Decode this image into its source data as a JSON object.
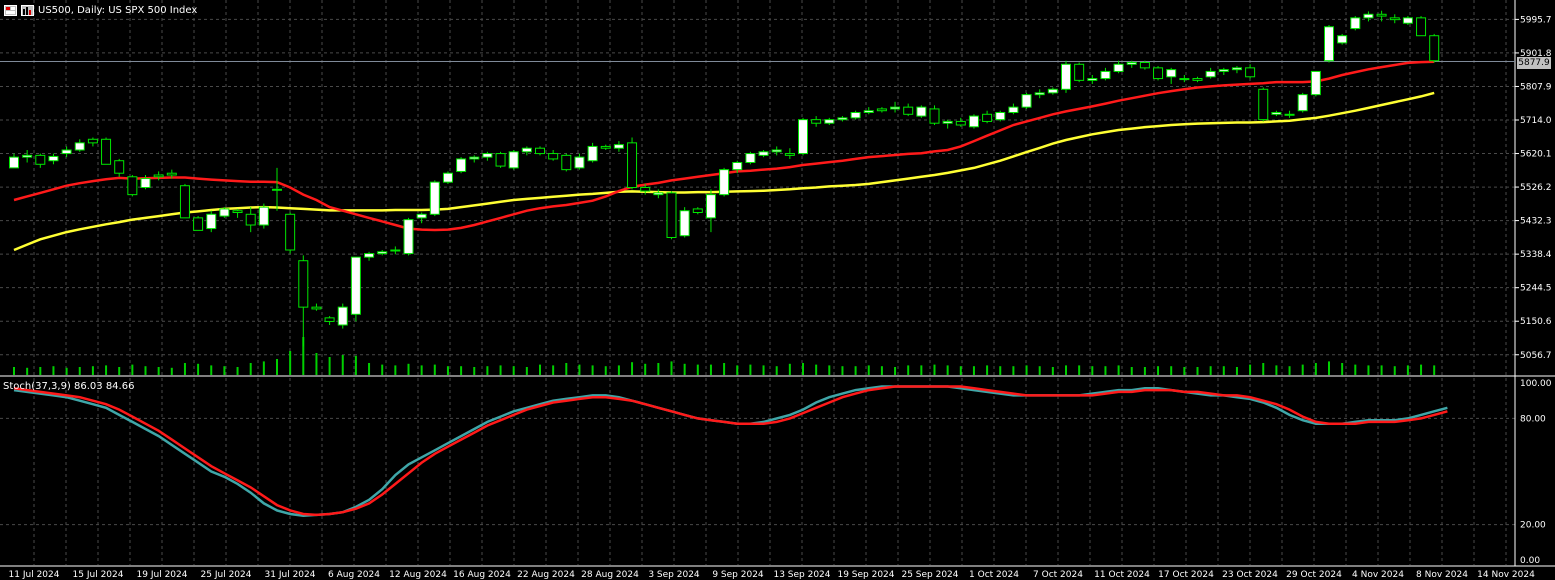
{
  "header": {
    "symbol": "US500",
    "timeframe": "Daily",
    "description": "US SPX 500 Index",
    "title": "US500, Daily:  US SPX 500 Index",
    "icons": [
      "window-grid-icon",
      "bar-chart-icon"
    ]
  },
  "indicator": {
    "label": "Stoch(37,3,9) 86.03 84.66",
    "name": "Stoch(37,3,9)",
    "main_value": 86.03,
    "signal_value": 84.66
  },
  "colors": {
    "background": "#000000",
    "grid": "#4a4a4a",
    "bull_body": "#ffffff",
    "bear_body": "#000000",
    "wick": "#00e600",
    "volume": "#00d000",
    "ma_fast": "#ff1a1a",
    "ma_slow": "#ffff33",
    "stoch_main": "#3fa6a8",
    "stoch_signal": "#ff1a1a",
    "current_price_line": "#7f8a99"
  },
  "chart_data": {
    "type": "candlestick",
    "current_price": 5877.9,
    "current_price_label": "5877.9",
    "price_axis": {
      "range": [
        5000,
        6050
      ],
      "tick_labels": [
        "5995.7",
        "5901.8",
        "5807.9",
        "5714.0",
        "5620.1",
        "5526.2",
        "5432.3",
        "5338.4",
        "5244.5",
        "5150.6",
        "5056.7"
      ]
    },
    "date_labels": [
      "11 Jul 2024",
      "15 Jul 2024",
      "19 Jul 2024",
      "25 Jul 2024",
      "31 Jul 2024",
      "6 Aug 2024",
      "12 Aug 2024",
      "16 Aug 2024",
      "22 Aug 2024",
      "28 Aug 2024",
      "3 Sep 2024",
      "9 Sep 2024",
      "13 Sep 2024",
      "19 Sep 2024",
      "25 Sep 2024",
      "1 Oct 2024",
      "7 Oct 2024",
      "11 Oct 2024",
      "17 Oct 2024",
      "23 Oct 2024",
      "29 Oct 2024",
      "4 Nov 2024",
      "8 Nov 2024",
      "14 Nov 2024"
    ],
    "candles": [
      [
        5580,
        5620,
        5580,
        5610
      ],
      [
        5610,
        5630,
        5595,
        5615
      ],
      [
        5615,
        5620,
        5580,
        5590
      ],
      [
        5600,
        5620,
        5590,
        5612
      ],
      [
        5620,
        5640,
        5610,
        5630
      ],
      [
        5630,
        5660,
        5625,
        5650
      ],
      [
        5660,
        5665,
        5640,
        5650
      ],
      [
        5660,
        5665,
        5590,
        5590
      ],
      [
        5600,
        5605,
        5555,
        5565
      ],
      [
        5555,
        5560,
        5500,
        5505
      ],
      [
        5525,
        5560,
        5520,
        5550
      ],
      [
        5560,
        5570,
        5545,
        5555
      ],
      [
        5565,
        5575,
        5550,
        5560
      ],
      [
        5530,
        5535,
        5440,
        5440
      ],
      [
        5440,
        5445,
        5405,
        5405
      ],
      [
        5410,
        5460,
        5400,
        5450
      ],
      [
        5445,
        5470,
        5440,
        5465
      ],
      [
        5460,
        5465,
        5440,
        5455
      ],
      [
        5450,
        5470,
        5400,
        5420
      ],
      [
        5420,
        5480,
        5410,
        5470
      ],
      [
        5520,
        5580,
        5460,
        5520
      ],
      [
        5450,
        5455,
        5340,
        5350
      ],
      [
        5320,
        5335,
        5080,
        5190
      ],
      [
        5190,
        5200,
        5180,
        5185
      ],
      [
        5160,
        5165,
        5140,
        5150
      ],
      [
        5140,
        5200,
        5130,
        5190
      ],
      [
        5170,
        5330,
        5150,
        5330
      ],
      [
        5330,
        5345,
        5320,
        5340
      ],
      [
        5340,
        5350,
        5335,
        5345
      ],
      [
        5350,
        5360,
        5338,
        5350
      ],
      [
        5340,
        5440,
        5335,
        5435
      ],
      [
        5440,
        5455,
        5425,
        5450
      ],
      [
        5450,
        5545,
        5445,
        5540
      ],
      [
        5540,
        5570,
        5535,
        5565
      ],
      [
        5570,
        5610,
        5565,
        5605
      ],
      [
        5605,
        5615,
        5595,
        5610
      ],
      [
        5610,
        5625,
        5600,
        5620
      ],
      [
        5620,
        5625,
        5580,
        5585
      ],
      [
        5580,
        5630,
        5575,
        5625
      ],
      [
        5625,
        5640,
        5615,
        5635
      ],
      [
        5635,
        5640,
        5615,
        5620
      ],
      [
        5620,
        5630,
        5600,
        5605
      ],
      [
        5615,
        5620,
        5570,
        5575
      ],
      [
        5580,
        5620,
        5575,
        5610
      ],
      [
        5600,
        5650,
        5595,
        5640
      ],
      [
        5640,
        5645,
        5630,
        5635
      ],
      [
        5635,
        5655,
        5625,
        5645
      ],
      [
        5650,
        5665,
        5520,
        5525
      ],
      [
        5525,
        5535,
        5505,
        5515
      ],
      [
        5505,
        5520,
        5495,
        5510
      ],
      [
        5510,
        5515,
        5380,
        5385
      ],
      [
        5390,
        5470,
        5385,
        5460
      ],
      [
        5465,
        5470,
        5450,
        5455
      ],
      [
        5440,
        5520,
        5400,
        5505
      ],
      [
        5505,
        5580,
        5500,
        5575
      ],
      [
        5575,
        5600,
        5565,
        5595
      ],
      [
        5595,
        5625,
        5590,
        5620
      ],
      [
        5615,
        5630,
        5610,
        5625
      ],
      [
        5625,
        5640,
        5615,
        5630
      ],
      [
        5620,
        5635,
        5605,
        5615
      ],
      [
        5620,
        5720,
        5615,
        5715
      ],
      [
        5715,
        5725,
        5695,
        5705
      ],
      [
        5705,
        5720,
        5700,
        5715
      ],
      [
        5715,
        5725,
        5710,
        5720
      ],
      [
        5720,
        5740,
        5715,
        5735
      ],
      [
        5735,
        5750,
        5730,
        5740
      ],
      [
        5745,
        5750,
        5735,
        5740
      ],
      [
        5745,
        5765,
        5735,
        5750
      ],
      [
        5750,
        5760,
        5725,
        5730
      ],
      [
        5725,
        5755,
        5720,
        5750
      ],
      [
        5745,
        5755,
        5700,
        5705
      ],
      [
        5705,
        5715,
        5690,
        5710
      ],
      [
        5710,
        5720,
        5695,
        5700
      ],
      [
        5695,
        5730,
        5690,
        5725
      ],
      [
        5730,
        5740,
        5705,
        5710
      ],
      [
        5715,
        5740,
        5710,
        5735
      ],
      [
        5735,
        5760,
        5730,
        5750
      ],
      [
        5750,
        5790,
        5745,
        5785
      ],
      [
        5785,
        5800,
        5775,
        5790
      ],
      [
        5790,
        5805,
        5785,
        5800
      ],
      [
        5800,
        5880,
        5790,
        5870
      ],
      [
        5870,
        5875,
        5820,
        5825
      ],
      [
        5825,
        5840,
        5815,
        5830
      ],
      [
        5830,
        5860,
        5825,
        5850
      ],
      [
        5850,
        5880,
        5845,
        5870
      ],
      [
        5870,
        5880,
        5860,
        5875
      ],
      [
        5875,
        5880,
        5855,
        5860
      ],
      [
        5860,
        5865,
        5825,
        5830
      ],
      [
        5835,
        5860,
        5815,
        5855
      ],
      [
        5830,
        5840,
        5820,
        5830
      ],
      [
        5830,
        5835,
        5820,
        5825
      ],
      [
        5835,
        5860,
        5830,
        5850
      ],
      [
        5850,
        5860,
        5840,
        5855
      ],
      [
        5855,
        5865,
        5845,
        5860
      ],
      [
        5860,
        5870,
        5830,
        5835
      ],
      [
        5800,
        5805,
        5710,
        5715
      ],
      [
        5730,
        5740,
        5725,
        5735
      ],
      [
        5730,
        5740,
        5720,
        5730
      ],
      [
        5740,
        5790,
        5735,
        5785
      ],
      [
        5785,
        5850,
        5780,
        5850
      ],
      [
        5880,
        5980,
        5875,
        5975
      ],
      [
        5930,
        5955,
        5925,
        5950
      ],
      [
        5970,
        6005,
        5965,
        6000
      ],
      [
        6000,
        6018,
        5990,
        6010
      ],
      [
        6010,
        6020,
        5990,
        6005
      ],
      [
        6000,
        6010,
        5985,
        5995
      ],
      [
        5985,
        6005,
        5980,
        6000
      ],
      [
        6000,
        6005,
        5950,
        5950
      ],
      [
        5950,
        5955,
        5875,
        5880
      ]
    ],
    "volume": [
      0.2,
      0.18,
      0.2,
      0.22,
      0.18,
      0.2,
      0.22,
      0.24,
      0.2,
      0.26,
      0.22,
      0.2,
      0.18,
      0.3,
      0.28,
      0.24,
      0.22,
      0.2,
      0.3,
      0.34,
      0.4,
      0.6,
      0.95,
      0.55,
      0.45,
      0.5,
      0.48,
      0.3,
      0.26,
      0.24,
      0.28,
      0.24,
      0.26,
      0.22,
      0.22,
      0.2,
      0.22,
      0.24,
      0.22,
      0.2,
      0.26,
      0.24,
      0.3,
      0.26,
      0.24,
      0.22,
      0.24,
      0.32,
      0.28,
      0.3,
      0.34,
      0.28,
      0.26,
      0.26,
      0.3,
      0.24,
      0.26,
      0.24,
      0.22,
      0.28,
      0.3,
      0.26,
      0.24,
      0.22,
      0.22,
      0.24,
      0.22,
      0.2,
      0.24,
      0.24,
      0.26,
      0.24,
      0.22,
      0.22,
      0.24,
      0.22,
      0.22,
      0.24,
      0.22,
      0.2,
      0.24,
      0.24,
      0.22,
      0.22,
      0.24,
      0.2,
      0.2,
      0.22,
      0.22,
      0.2,
      0.2,
      0.22,
      0.22,
      0.2,
      0.26,
      0.3,
      0.24,
      0.22,
      0.26,
      0.3,
      0.34,
      0.3,
      0.26,
      0.24,
      0.24,
      0.22,
      0.24,
      0.26,
      0.24
    ],
    "ma_fast": [
      5490,
      5500,
      5510,
      5520,
      5530,
      5537,
      5543,
      5548,
      5552,
      5550,
      5551,
      5552,
      5553,
      5553,
      5550,
      5547,
      5545,
      5543,
      5541,
      5541,
      5540,
      5525,
      5505,
      5490,
      5470,
      5460,
      5450,
      5440,
      5430,
      5420,
      5410,
      5407,
      5406,
      5407,
      5412,
      5420,
      5430,
      5440,
      5450,
      5460,
      5467,
      5472,
      5476,
      5482,
      5488,
      5500,
      5515,
      5527,
      5533,
      5538,
      5545,
      5550,
      5555,
      5560,
      5565,
      5570,
      5572,
      5575,
      5578,
      5582,
      5588,
      5592,
      5596,
      5600,
      5605,
      5610,
      5613,
      5616,
      5619,
      5621,
      5626,
      5630,
      5640,
      5655,
      5670,
      5685,
      5700,
      5710,
      5720,
      5730,
      5738,
      5745,
      5752,
      5760,
      5768,
      5775,
      5782,
      5789,
      5795,
      5800,
      5805,
      5808,
      5811,
      5813,
      5815,
      5817,
      5820,
      5820,
      5820,
      5822,
      5830,
      5840,
      5848,
      5856,
      5862,
      5868,
      5874,
      5876,
      5877
    ],
    "ma_slow": [
      5350,
      5365,
      5380,
      5390,
      5400,
      5408,
      5415,
      5422,
      5428,
      5435,
      5440,
      5445,
      5450,
      5455,
      5458,
      5462,
      5465,
      5467,
      5469,
      5470,
      5469,
      5467,
      5465,
      5463,
      5461,
      5461,
      5461,
      5461,
      5461,
      5462,
      5462,
      5462,
      5463,
      5465,
      5470,
      5475,
      5480,
      5485,
      5490,
      5493,
      5496,
      5499,
      5502,
      5505,
      5507,
      5510,
      5513,
      5514,
      5513,
      5512,
      5511,
      5511,
      5512,
      5512,
      5513,
      5514,
      5515,
      5516,
      5518,
      5520,
      5523,
      5525,
      5528,
      5530,
      5532,
      5535,
      5540,
      5545,
      5550,
      5555,
      5560,
      5566,
      5573,
      5580,
      5590,
      5600,
      5612,
      5624,
      5636,
      5648,
      5658,
      5666,
      5674,
      5680,
      5686,
      5690,
      5694,
      5697,
      5700,
      5702,
      5704,
      5705,
      5706,
      5707,
      5707,
      5708,
      5710,
      5712,
      5716,
      5720,
      5726,
      5733,
      5740,
      5748,
      5756,
      5764,
      5772,
      5780,
      5790
    ],
    "stoch_axis": {
      "range": [
        0,
        100
      ],
      "tick_labels": [
        "100.00",
        "80.00",
        "20.00",
        "0.00"
      ]
    },
    "stoch_main": [
      96,
      95,
      94,
      93,
      92,
      90,
      88,
      86,
      82,
      78,
      74,
      70,
      65,
      60,
      55,
      50,
      47,
      43,
      38,
      32,
      28,
      26,
      25,
      25.5,
      26,
      27,
      30,
      34,
      40,
      48,
      54,
      58,
      62,
      66,
      70,
      74,
      78,
      81,
      84,
      86,
      88,
      90,
      91,
      92,
      93,
      93,
      92,
      90,
      88,
      86,
      84,
      82,
      80,
      79,
      78,
      77,
      77,
      78,
      80,
      82,
      85,
      89,
      92,
      94,
      96,
      97,
      98,
      98,
      98,
      98,
      98,
      98,
      97,
      96,
      95,
      94,
      93,
      93,
      93,
      93,
      93,
      93,
      94,
      95,
      96,
      96,
      97,
      97,
      96,
      95,
      94,
      93,
      93,
      92,
      91,
      89,
      86,
      82,
      79,
      77,
      77,
      77,
      78,
      79,
      79,
      79,
      80,
      82,
      84,
      86
    ],
    "stoch_signal": [
      97,
      96,
      95,
      94,
      93,
      92,
      90,
      88,
      85,
      81,
      77,
      73,
      68,
      63,
      58,
      53,
      49,
      45,
      41,
      36,
      31,
      28,
      26,
      25.5,
      26,
      27,
      29,
      32,
      37,
      43,
      49,
      55,
      60,
      64,
      68,
      72,
      76,
      79,
      82,
      85,
      87,
      89,
      90,
      91,
      92,
      92,
      91,
      90,
      88,
      86,
      84,
      82,
      80,
      79,
      78,
      77,
      77,
      77,
      78,
      80,
      83,
      86,
      89,
      92,
      94,
      96,
      97,
      98,
      98,
      98,
      98,
      98,
      98,
      97,
      96,
      95,
      94,
      93,
      93,
      93,
      93,
      93,
      93,
      94,
      95,
      95,
      96,
      96,
      96,
      95,
      95,
      94,
      93,
      93,
      92,
      90,
      88,
      85,
      81,
      78,
      77,
      77,
      77,
      78,
      78,
      78,
      79,
      80,
      82,
      84
    ]
  }
}
